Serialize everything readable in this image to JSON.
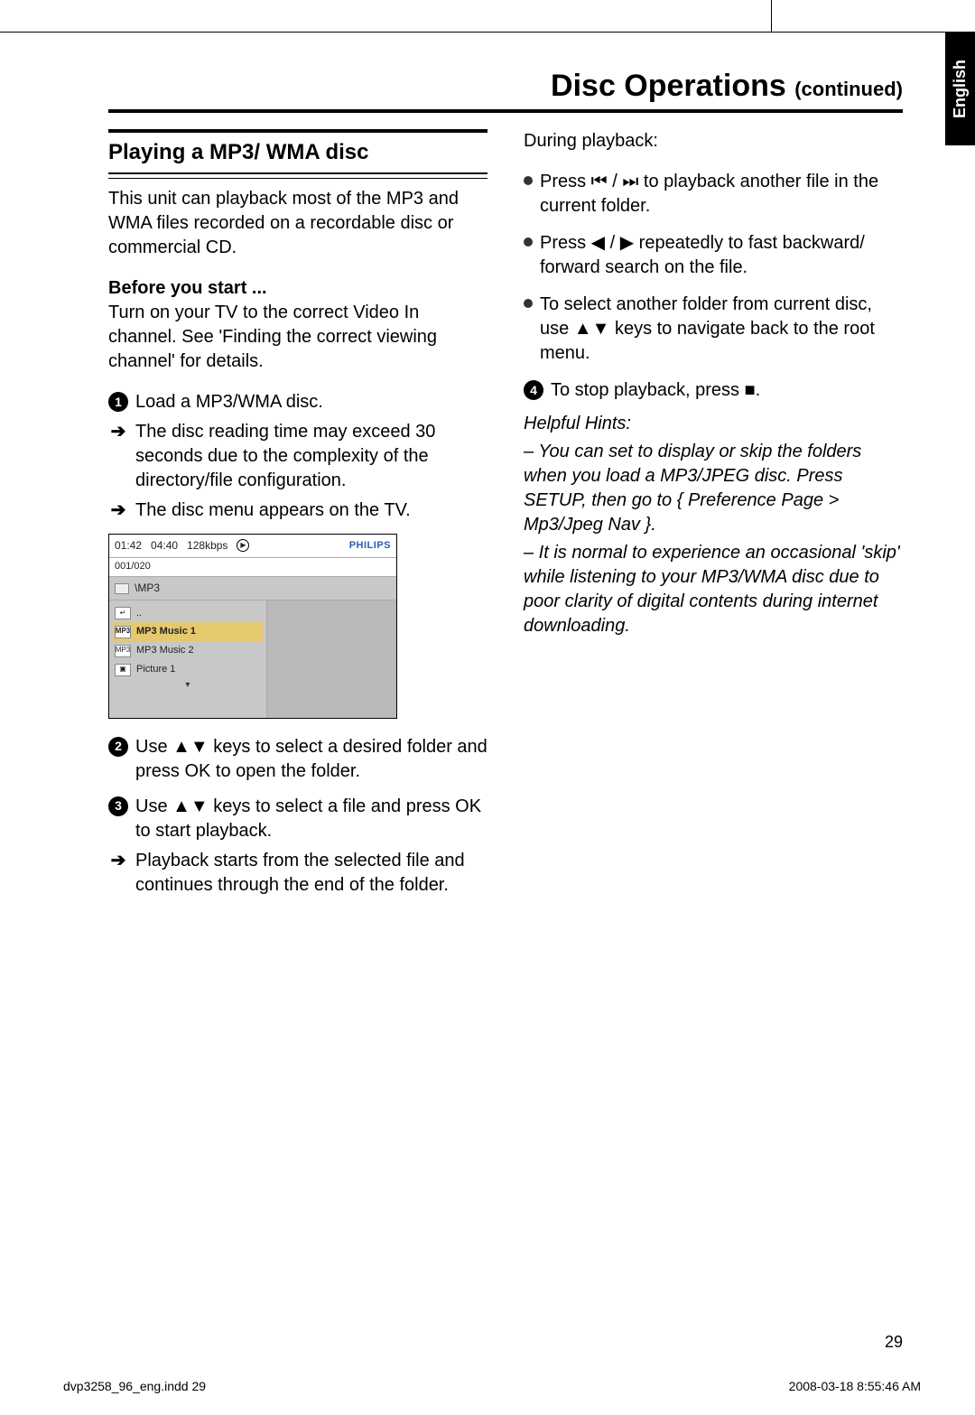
{
  "header": {
    "title": "Disc Operations",
    "continued": "(continued)"
  },
  "langTab": "English",
  "left": {
    "sectionTitle": "Playing a MP3/ WMA disc",
    "intro": "This unit can playback most of the MP3 and WMA files recorded on a recordable disc or commercial CD.",
    "beforeLabel": "Before you start ...",
    "beforeText": "Turn on your TV to the correct Video In channel. See 'Finding the correct viewing channel' for details.",
    "step1": {
      "num": "1",
      "text": "Load a MP3/WMA disc."
    },
    "step1a": "The disc reading time may exceed 30 seconds due to the complexity of the directory/file configuration.",
    "step1b": "The disc menu appears on the TV.",
    "tv": {
      "time1": "01:42",
      "time2": "04:40",
      "kbps": "128kbps",
      "counter": "001/020",
      "logo": "PHILIPS",
      "path": "\\MP3",
      "items": [
        {
          "icon": "up",
          "label": ".."
        },
        {
          "icon": "mp3",
          "label": "MP3 Music 1",
          "selected": true
        },
        {
          "icon": "mp3",
          "label": "MP3 Music 2"
        },
        {
          "icon": "pic",
          "label": "Picture 1"
        }
      ]
    },
    "step2": {
      "num": "2",
      "text": "Use ▲▼ keys to select a desired folder and press OK to open the folder."
    },
    "step3": {
      "num": "3",
      "text": "Use ▲▼ keys to select a file and press OK to start playback."
    },
    "step3a": "Playback starts from the selected file and continues through the end of the folder."
  },
  "right": {
    "during": "During playback:",
    "b1": "Press  ⏮ / ⏭ to playback another file in the current folder.",
    "b2": "Press ◀ / ▶ repeatedly to fast backward/ forward search on the file.",
    "b3": "To select another folder from current disc, use ▲▼ keys to navigate back to the root menu.",
    "step4": {
      "num": "4",
      "text": "To stop playback, press ■."
    },
    "hintsLabel": "Helpful Hints:",
    "hint1": "–  You can set to display or skip the folders when you load a MP3/JPEG disc. Press SETUP, then go to { Preference Page > Mp3/Jpeg Nav }.",
    "hint2": "–  It is normal to experience an occasional 'skip' while listening to your MP3/WMA disc due to poor clarity of digital contents during internet downloading."
  },
  "pageNumber": "29",
  "footer": {
    "left": "dvp3258_96_eng.indd   29",
    "right": "2008-03-18   8:55:46 AM"
  }
}
